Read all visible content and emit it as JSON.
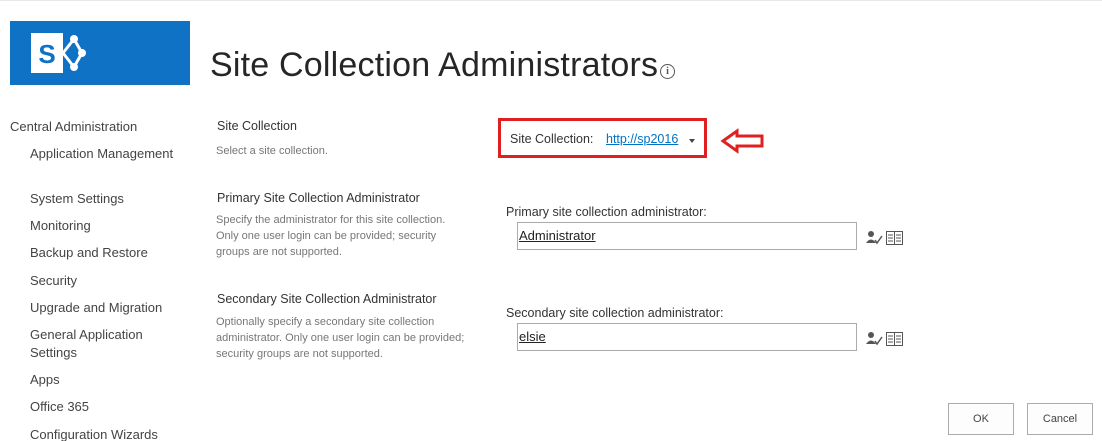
{
  "page": {
    "title": "Site Collection Administrators",
    "info_icon": "info-icon"
  },
  "nav": {
    "root": "Central Administration",
    "items": [
      {
        "label": "Application Management"
      },
      {
        "label": "System Settings"
      },
      {
        "label": "Monitoring"
      },
      {
        "label": "Backup and Restore"
      },
      {
        "label": "Security"
      },
      {
        "label": "Upgrade and Migration"
      },
      {
        "label": "General Application Settings"
      },
      {
        "label": "Apps"
      },
      {
        "label": "Office 365"
      },
      {
        "label": "Configuration Wizards"
      }
    ]
  },
  "sections": {
    "site_collection": {
      "title": "Site Collection",
      "description": "Select a site collection."
    },
    "primary": {
      "title": "Primary Site Collection Administrator",
      "description": "Specify the administrator for this site collection. Only one user login can be provided; security groups are not supported."
    },
    "secondary": {
      "title": "Secondary Site Collection Administrator",
      "description": "Optionally specify a secondary site collection administrator. Only one user login can be provided; security groups are not supported."
    }
  },
  "site_collection_selector": {
    "label": "Site Collection:",
    "value": "http://sp2016"
  },
  "primary_field": {
    "label": "Primary site collection administrator:",
    "value": "Administrator"
  },
  "secondary_field": {
    "label": "Secondary site collection administrator:",
    "value": "elsie"
  },
  "buttons": {
    "ok": "OK",
    "cancel": "Cancel"
  },
  "colors": {
    "brand": "#0f72c4",
    "link": "#0072c6",
    "highlight": "#e02020"
  }
}
